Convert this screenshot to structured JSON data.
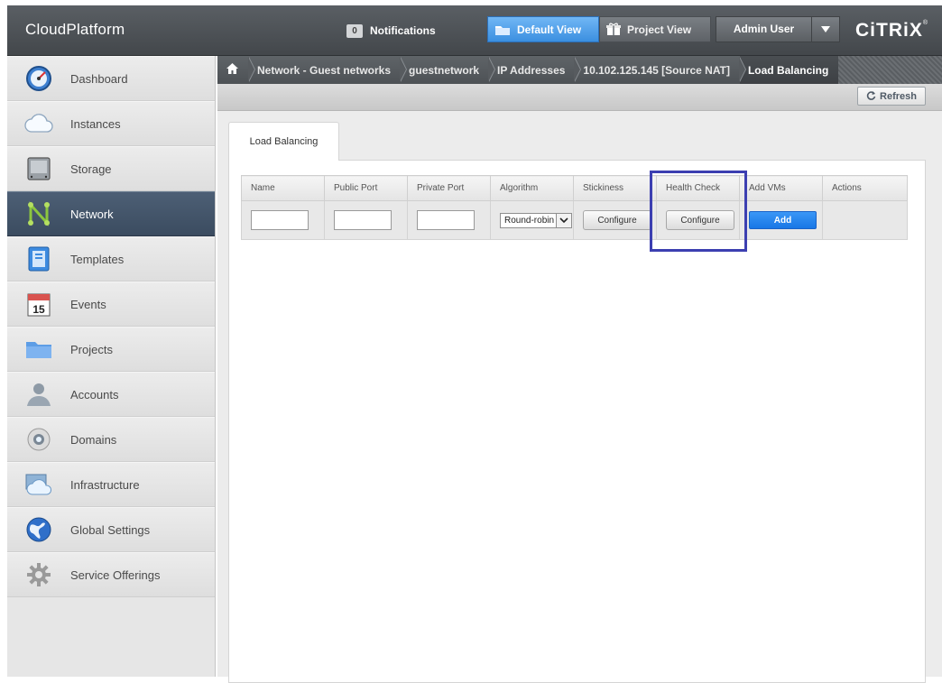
{
  "header": {
    "app_title": "CloudPlatform",
    "notifications": {
      "count": "0",
      "label": "Notifications"
    },
    "views": [
      {
        "label": "Default View",
        "active": true
      },
      {
        "label": "Project View",
        "active": false
      }
    ],
    "user": {
      "label": "Admin User"
    },
    "brand": "CiTRiX",
    "brand_mark": "®"
  },
  "sidebar": {
    "items": [
      {
        "label": "Dashboard",
        "icon": "dashboard-icon"
      },
      {
        "label": "Instances",
        "icon": "cloud-icon"
      },
      {
        "label": "Storage",
        "icon": "storage-icon"
      },
      {
        "label": "Network",
        "icon": "network-icon",
        "active": true
      },
      {
        "label": "Templates",
        "icon": "templates-icon"
      },
      {
        "label": "Events",
        "icon": "calendar-icon",
        "icon_text": "15"
      },
      {
        "label": "Projects",
        "icon": "folder-icon"
      },
      {
        "label": "Accounts",
        "icon": "user-icon"
      },
      {
        "label": "Domains",
        "icon": "domain-icon"
      },
      {
        "label": "Infrastructure",
        "icon": "infrastructure-icon"
      },
      {
        "label": "Global Settings",
        "icon": "globe-icon"
      },
      {
        "label": "Service Offerings",
        "icon": "gear-icon"
      }
    ]
  },
  "breadcrumb": {
    "items": [
      {
        "label": "Network - Guest networks"
      },
      {
        "label": "guestnetwork"
      },
      {
        "label": "IP Addresses"
      },
      {
        "label": "10.102.125.145 [Source NAT]"
      },
      {
        "label": "Load Balancing"
      }
    ]
  },
  "toolbar": {
    "refresh_label": "Refresh"
  },
  "tabs": [
    {
      "label": "Load Balancing"
    }
  ],
  "lb_table": {
    "columns": [
      "Name",
      "Public Port",
      "Private Port",
      "Algorithm",
      "Stickiness",
      "Health Check",
      "Add VMs",
      "Actions"
    ],
    "row": {
      "name": "",
      "public_port": "",
      "private_port": "",
      "algorithm": "Round-robin",
      "stickiness_button": "Configure",
      "health_check_button": "Configure",
      "add_vms_button": "Add"
    }
  },
  "colors": {
    "header": "#4b4f53",
    "nav_active": "#44566b",
    "add_button": "#1f7fe9",
    "highlight": "#3c3fb1",
    "default_view": "#4a9aea"
  }
}
